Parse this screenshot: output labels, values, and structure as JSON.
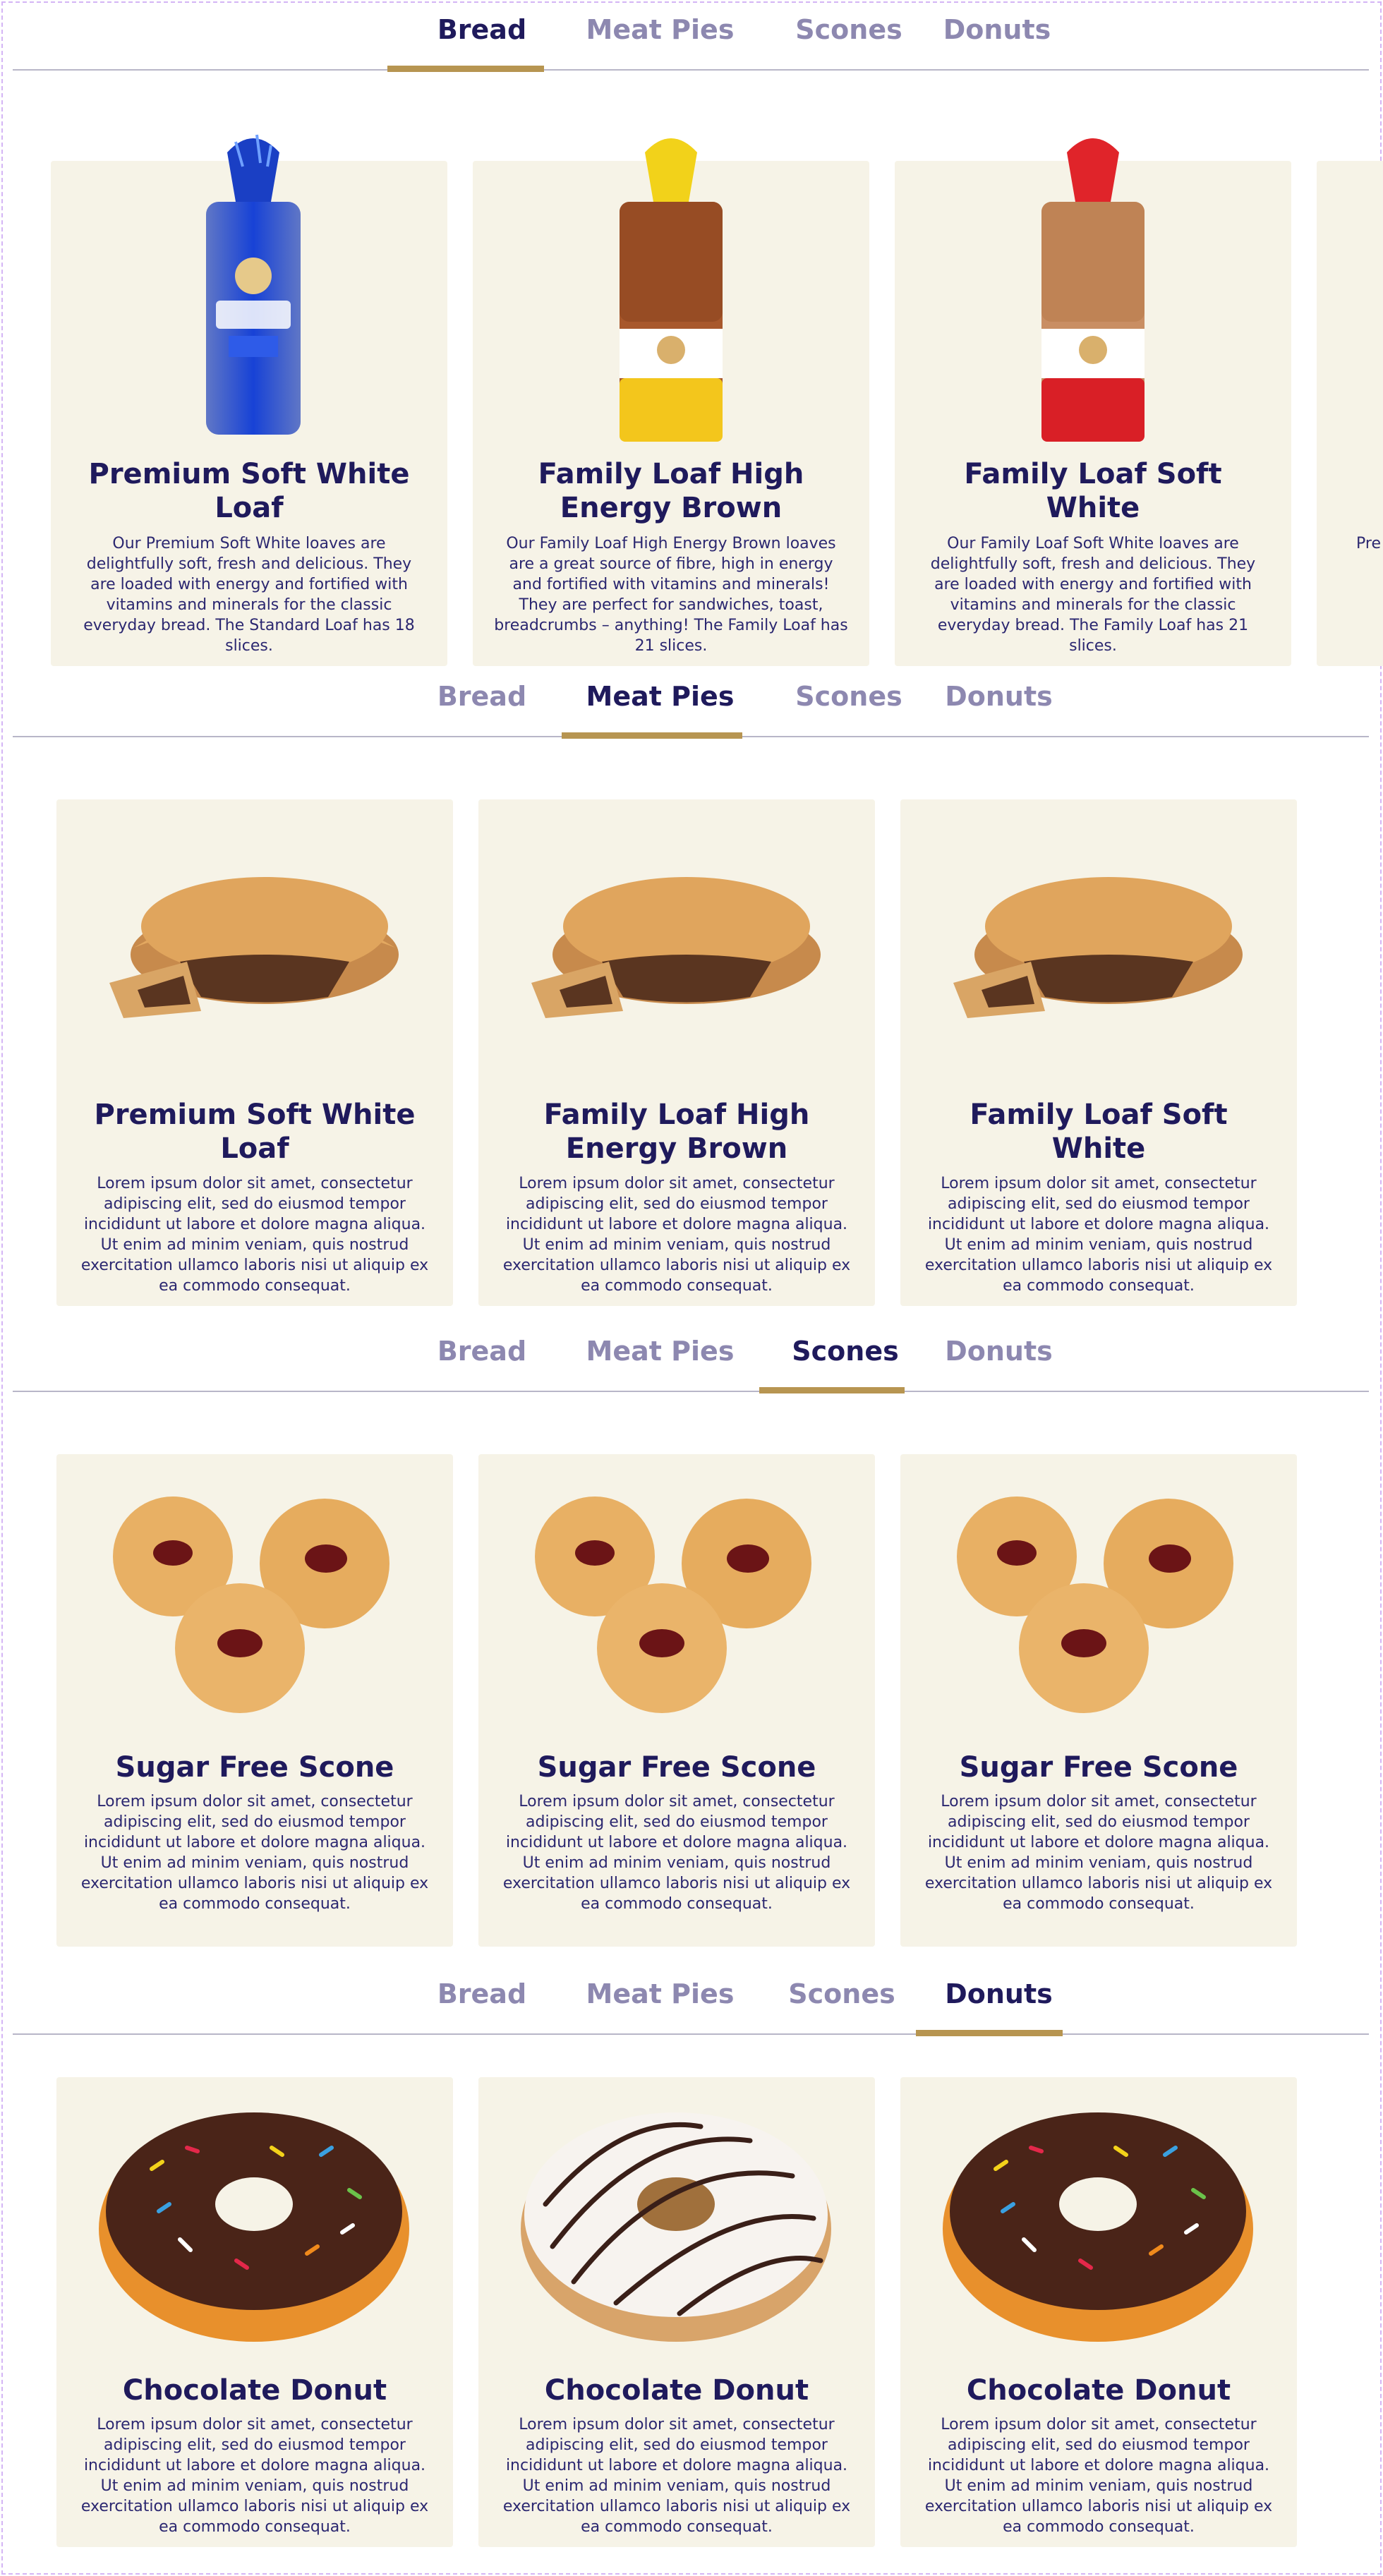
{
  "tabs": [
    "Bread",
    "Meat Pies",
    "Scones",
    "Donuts"
  ],
  "sections": [
    {
      "active_tab": "Bread",
      "cards": [
        {
          "title": "Premium Soft White Loaf",
          "description": "Our Premium Soft White loaves are delightfully soft, fresh and delicious. They are loaded with energy and fortified with vitamins and minerals for the classic everyday bread. The Standard Loaf has 18 slices.",
          "image": "bread-blue-icon"
        },
        {
          "title": "Family Loaf High Energy Brown",
          "description": "Our Family Loaf High Energy Brown loaves are a great source of fibre, high in energy and fortified with vitamins and minerals! They are perfect for sandwiches, toast, breadcrumbs – anything! The Family Loaf has 21 slices.",
          "image": "bread-yellow-icon"
        },
        {
          "title": "Family Loaf Soft White",
          "description": "Our Family Loaf Soft White loaves are delightfully soft, fresh and delicious. They are loaded with energy and fortified with vitamins and minerals for the classic everyday bread. The Family Loaf has 21 slices.",
          "image": "bread-red-icon"
        }
      ],
      "peek_text": "Pre"
    },
    {
      "active_tab": "Meat Pies",
      "cards": [
        {
          "title": "Premium Soft White Loaf",
          "description": "Lorem ipsum dolor sit amet, consectetur adipiscing elit, sed do eiusmod tempor incididunt ut labore et dolore magna aliqua. Ut enim ad minim veniam, quis nostrud exercitation ullamco laboris nisi ut aliquip ex ea commodo consequat.",
          "image": "meat-pie-icon"
        },
        {
          "title": "Family Loaf High Energy Brown",
          "description": "Lorem ipsum dolor sit amet, consectetur adipiscing elit, sed do eiusmod tempor incididunt ut labore et dolore magna aliqua. Ut enim ad minim veniam, quis nostrud exercitation ullamco laboris nisi ut aliquip ex ea commodo consequat.",
          "image": "meat-pie-icon"
        },
        {
          "title": "Family Loaf Soft White",
          "description": "Lorem ipsum dolor sit amet, consectetur adipiscing elit, sed do eiusmod tempor incididunt ut labore et dolore magna aliqua. Ut enim ad minim veniam, quis nostrud exercitation ullamco laboris nisi ut aliquip ex ea commodo consequat.",
          "image": "meat-pie-icon"
        }
      ]
    },
    {
      "active_tab": "Scones",
      "cards": [
        {
          "title": "Sugar Free Scone",
          "description": "Lorem ipsum dolor sit amet, consectetur adipiscing elit, sed do eiusmod tempor incididunt ut labore et dolore magna aliqua. Ut enim ad minim veniam, quis nostrud exercitation ullamco laboris nisi ut aliquip ex ea commodo consequat.",
          "image": "jam-biscuits-icon"
        },
        {
          "title": "Sugar Free Scone",
          "description": "Lorem ipsum dolor sit amet, consectetur adipiscing elit, sed do eiusmod tempor incididunt ut labore et dolore magna aliqua. Ut enim ad minim veniam, quis nostrud exercitation ullamco laboris nisi ut aliquip ex ea commodo consequat.",
          "image": "jam-biscuits-icon"
        },
        {
          "title": "Sugar Free Scone",
          "description": "Lorem ipsum dolor sit amet, consectetur adipiscing elit, sed do eiusmod tempor incididunt ut labore et dolore magna aliqua. Ut enim ad minim veniam, quis nostrud exercitation ullamco laboris nisi ut aliquip ex ea commodo consequat.",
          "image": "jam-biscuits-icon"
        }
      ]
    },
    {
      "active_tab": "Donuts",
      "cards": [
        {
          "title": "Chocolate Donut",
          "description": "Lorem ipsum dolor sit amet, consectetur adipiscing elit, sed do eiusmod tempor incididunt ut labore et dolore magna aliqua. Ut enim ad minim veniam, quis nostrud exercitation ullamco laboris nisi ut aliquip ex ea commodo consequat.",
          "image": "chocolate-sprinkle-donut-icon"
        },
        {
          "title": "Chocolate Donut",
          "description": "Lorem ipsum dolor sit amet, consectetur adipiscing elit, sed do eiusmod tempor incididunt ut labore et dolore magna aliqua. Ut enim ad minim veniam, quis nostrud exercitation ullamco laboris nisi ut aliquip ex ea commodo consequat.",
          "image": "white-striped-donut-icon"
        },
        {
          "title": "Chocolate Donut",
          "description": "Lorem ipsum dolor sit amet, consectetur adipiscing elit, sed do eiusmod tempor incididunt ut labore et dolore magna aliqua. Ut enim ad minim veniam, quis nostrud exercitation ullamco laboris nisi ut aliquip ex ea commodo consequat.",
          "image": "chocolate-sprinkle-donut-icon"
        }
      ]
    }
  ],
  "colors": {
    "active_tab": "#1f1a5c",
    "inactive_tab": "#8d88b0",
    "underline": "#b79551",
    "card_bg": "#f6f3e7"
  }
}
